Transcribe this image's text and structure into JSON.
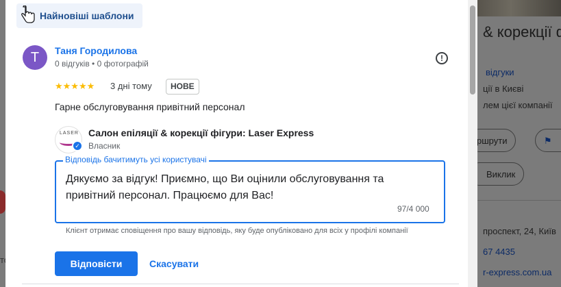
{
  "templates_chip": {
    "label": "Найновіші шаблони"
  },
  "review": {
    "avatar_letter": "Т",
    "author": "Таня Городилова",
    "author_meta": "0 відгуків • 0 фотографій",
    "stars": "★★★★★",
    "rating": 5,
    "time": "3 дні тому",
    "badge": "НОВЕ",
    "text": "Гарне обслуговування привітний персонал"
  },
  "owner": {
    "logo_text": "LASER",
    "name": "Салон епіляції & корекції фігури: Laser Express",
    "role": "Власник"
  },
  "reply": {
    "legend": "Відповідь бачитимуть усі користувачі",
    "text": "Дякуємо за відгук! Приємно, що Ви оцінили обслуговування та привітний персонал. Працюємо для Вас!",
    "counter": "97/4 000",
    "hint": "Клієнт отримає сповіщення про вашу відповідь, яку буде опубліковано для всіх у профілі компанії"
  },
  "actions": {
    "reply": "Відповісти",
    "cancel": "Скасувати"
  },
  "background": {
    "title": "& корекції ф",
    "reviews_link": "відгуки",
    "city_line": "ції в Києві",
    "owner_line": "лем цієї компанії",
    "routes_btn": "ршрути",
    "call_btn": "Виклик",
    "address": "проспект, 24, Київ",
    "phone": "67 4435",
    "site": "r-express.com.ua",
    "left_fragment": "то"
  },
  "colors": {
    "accent": "#1a73e8",
    "star": "#fbbc04",
    "avatar": "#7b57c6"
  }
}
